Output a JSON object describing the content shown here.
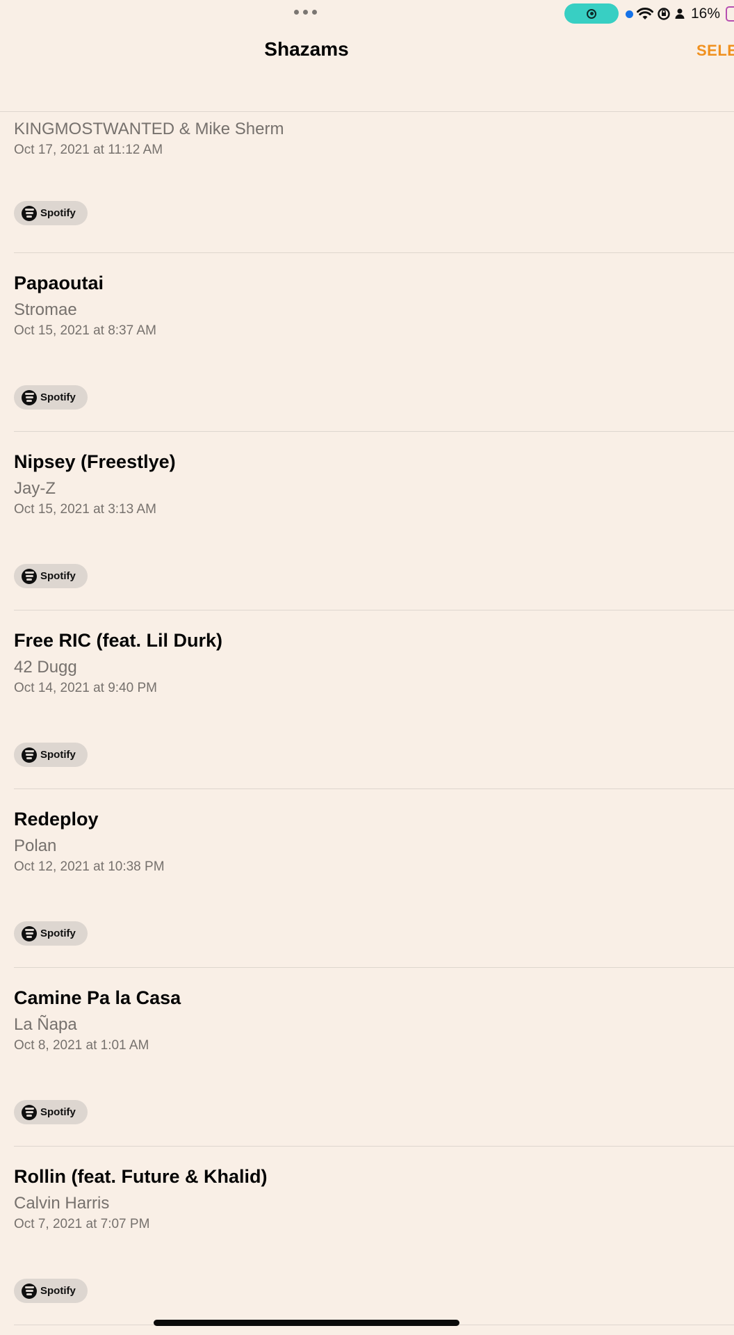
{
  "status_bar": {
    "battery_percent": "16%",
    "accent_color": "#38cfc3"
  },
  "nav": {
    "title": "Shazams",
    "select_label": "SELE"
  },
  "tracks": [
    {
      "title": "",
      "artist": "KINGMOSTWANTED & Mike Sherm",
      "date": "Oct 17, 2021 at 11:12 AM",
      "service": "Spotify"
    },
    {
      "title": "Papaoutai",
      "artist": "Stromae",
      "date": "Oct 15, 2021 at 8:37 AM",
      "service": "Spotify"
    },
    {
      "title": "Nipsey (Freestlye)",
      "artist": "Jay-Z",
      "date": "Oct 15, 2021 at 3:13 AM",
      "service": "Spotify"
    },
    {
      "title": "Free RIC (feat. Lil Durk)",
      "artist": "42 Dugg",
      "date": "Oct 14, 2021 at 9:40 PM",
      "service": "Spotify"
    },
    {
      "title": "Redeploy",
      "artist": "Polan",
      "date": "Oct 12, 2021 at 10:38 PM",
      "service": "Spotify"
    },
    {
      "title": "Camine Pa la Casa",
      "artist": "La Ñapa",
      "date": "Oct 8, 2021 at 1:01 AM",
      "service": "Spotify"
    },
    {
      "title": "Rollin (feat. Future & Khalid)",
      "artist": "Calvin Harris",
      "date": "Oct 7, 2021 at 7:07 PM",
      "service": "Spotify"
    }
  ],
  "colors": {
    "background": "#f9efe6",
    "accent": "#f0901e",
    "secondary_text": "#76716d"
  }
}
